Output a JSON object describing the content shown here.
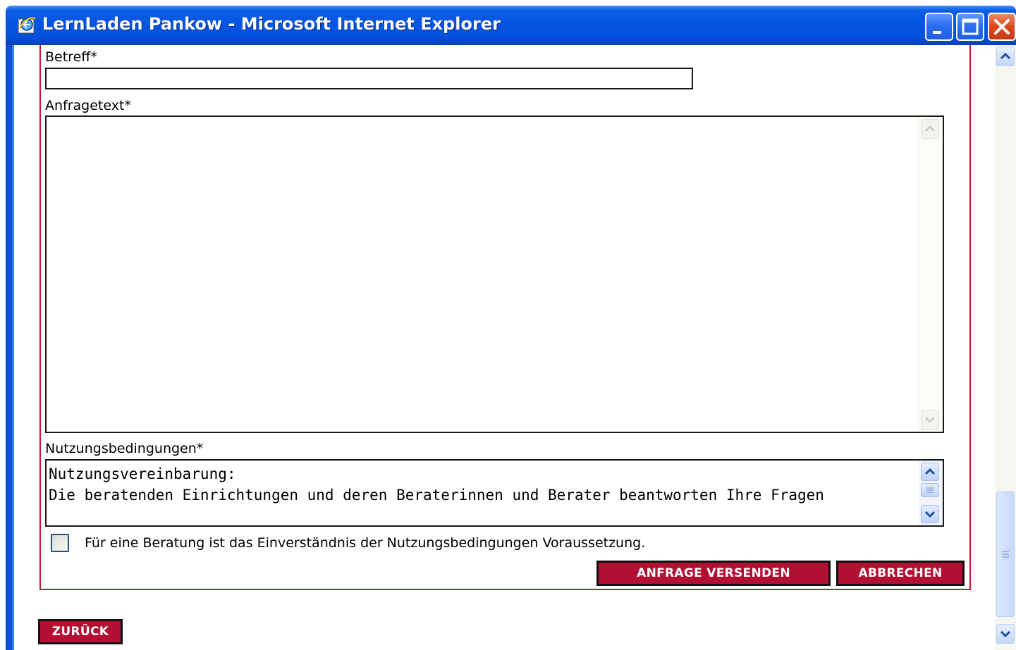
{
  "window": {
    "title": "LernLaden Pankow - Microsoft Internet Explorer",
    "buttons": {
      "minimize": "minimize-icon",
      "maximize": "maximize-icon",
      "close": "close-icon"
    }
  },
  "form": {
    "subject_label": "Betreff*",
    "subject_value": "",
    "request_label": "Anfragetext*",
    "request_value": "",
    "terms_label": "Nutzungsbedingungen*",
    "terms_text": "Nutzungsvereinbarung:\nDie beratenden Einrichtungen und deren Beraterinnen und Berater beantworten Ihre Fragen",
    "consent_checked": false,
    "consent_text": "Für eine Beratung ist das Einverständnis der Nutzungsbedingungen Voraussetzung.",
    "send_button": "ANFRAGE VERSENDEN",
    "cancel_button": "ABBRECHEN"
  },
  "back_button": "ZURÜCK",
  "colors": {
    "accent_red": "#b30f32",
    "panel_border": "#c01c3a",
    "titlebar_blue": "#0554e3"
  }
}
